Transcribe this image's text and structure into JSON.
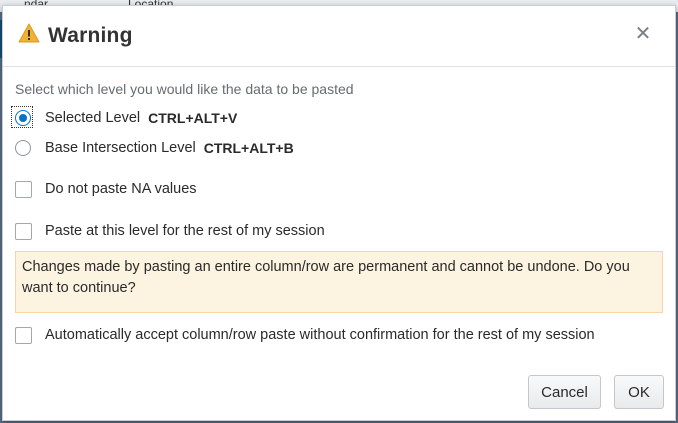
{
  "background": {
    "tab1": "...ndar",
    "tab2": "Location"
  },
  "dialog": {
    "title": "Warning",
    "icon": "warning-triangle-icon",
    "close_symbol": "✕",
    "prompt": "Select which level you would like the data to be pasted",
    "options": [
      {
        "label": "Selected Level",
        "shortcut": "CTRL+ALT+V",
        "selected": true
      },
      {
        "label": "Base Intersection Level",
        "shortcut": "CTRL+ALT+B",
        "selected": false
      }
    ],
    "checkboxes": [
      {
        "label": "Do not paste NA values",
        "checked": false
      },
      {
        "label": "Paste at this level for the rest of my session",
        "checked": false
      }
    ],
    "alert_text": "Changes made by pasting an entire column/row are permanent and cannot be undone. Do you want to continue?",
    "auto_accept": {
      "label": "Automatically accept column/row paste without confirmation for the rest of my session",
      "checked": false
    },
    "buttons": {
      "cancel": "Cancel",
      "ok": "OK"
    },
    "colors": {
      "accent": "#0572ce",
      "warning": "#f0b135",
      "alert_bg": "#fdf3e1"
    }
  }
}
